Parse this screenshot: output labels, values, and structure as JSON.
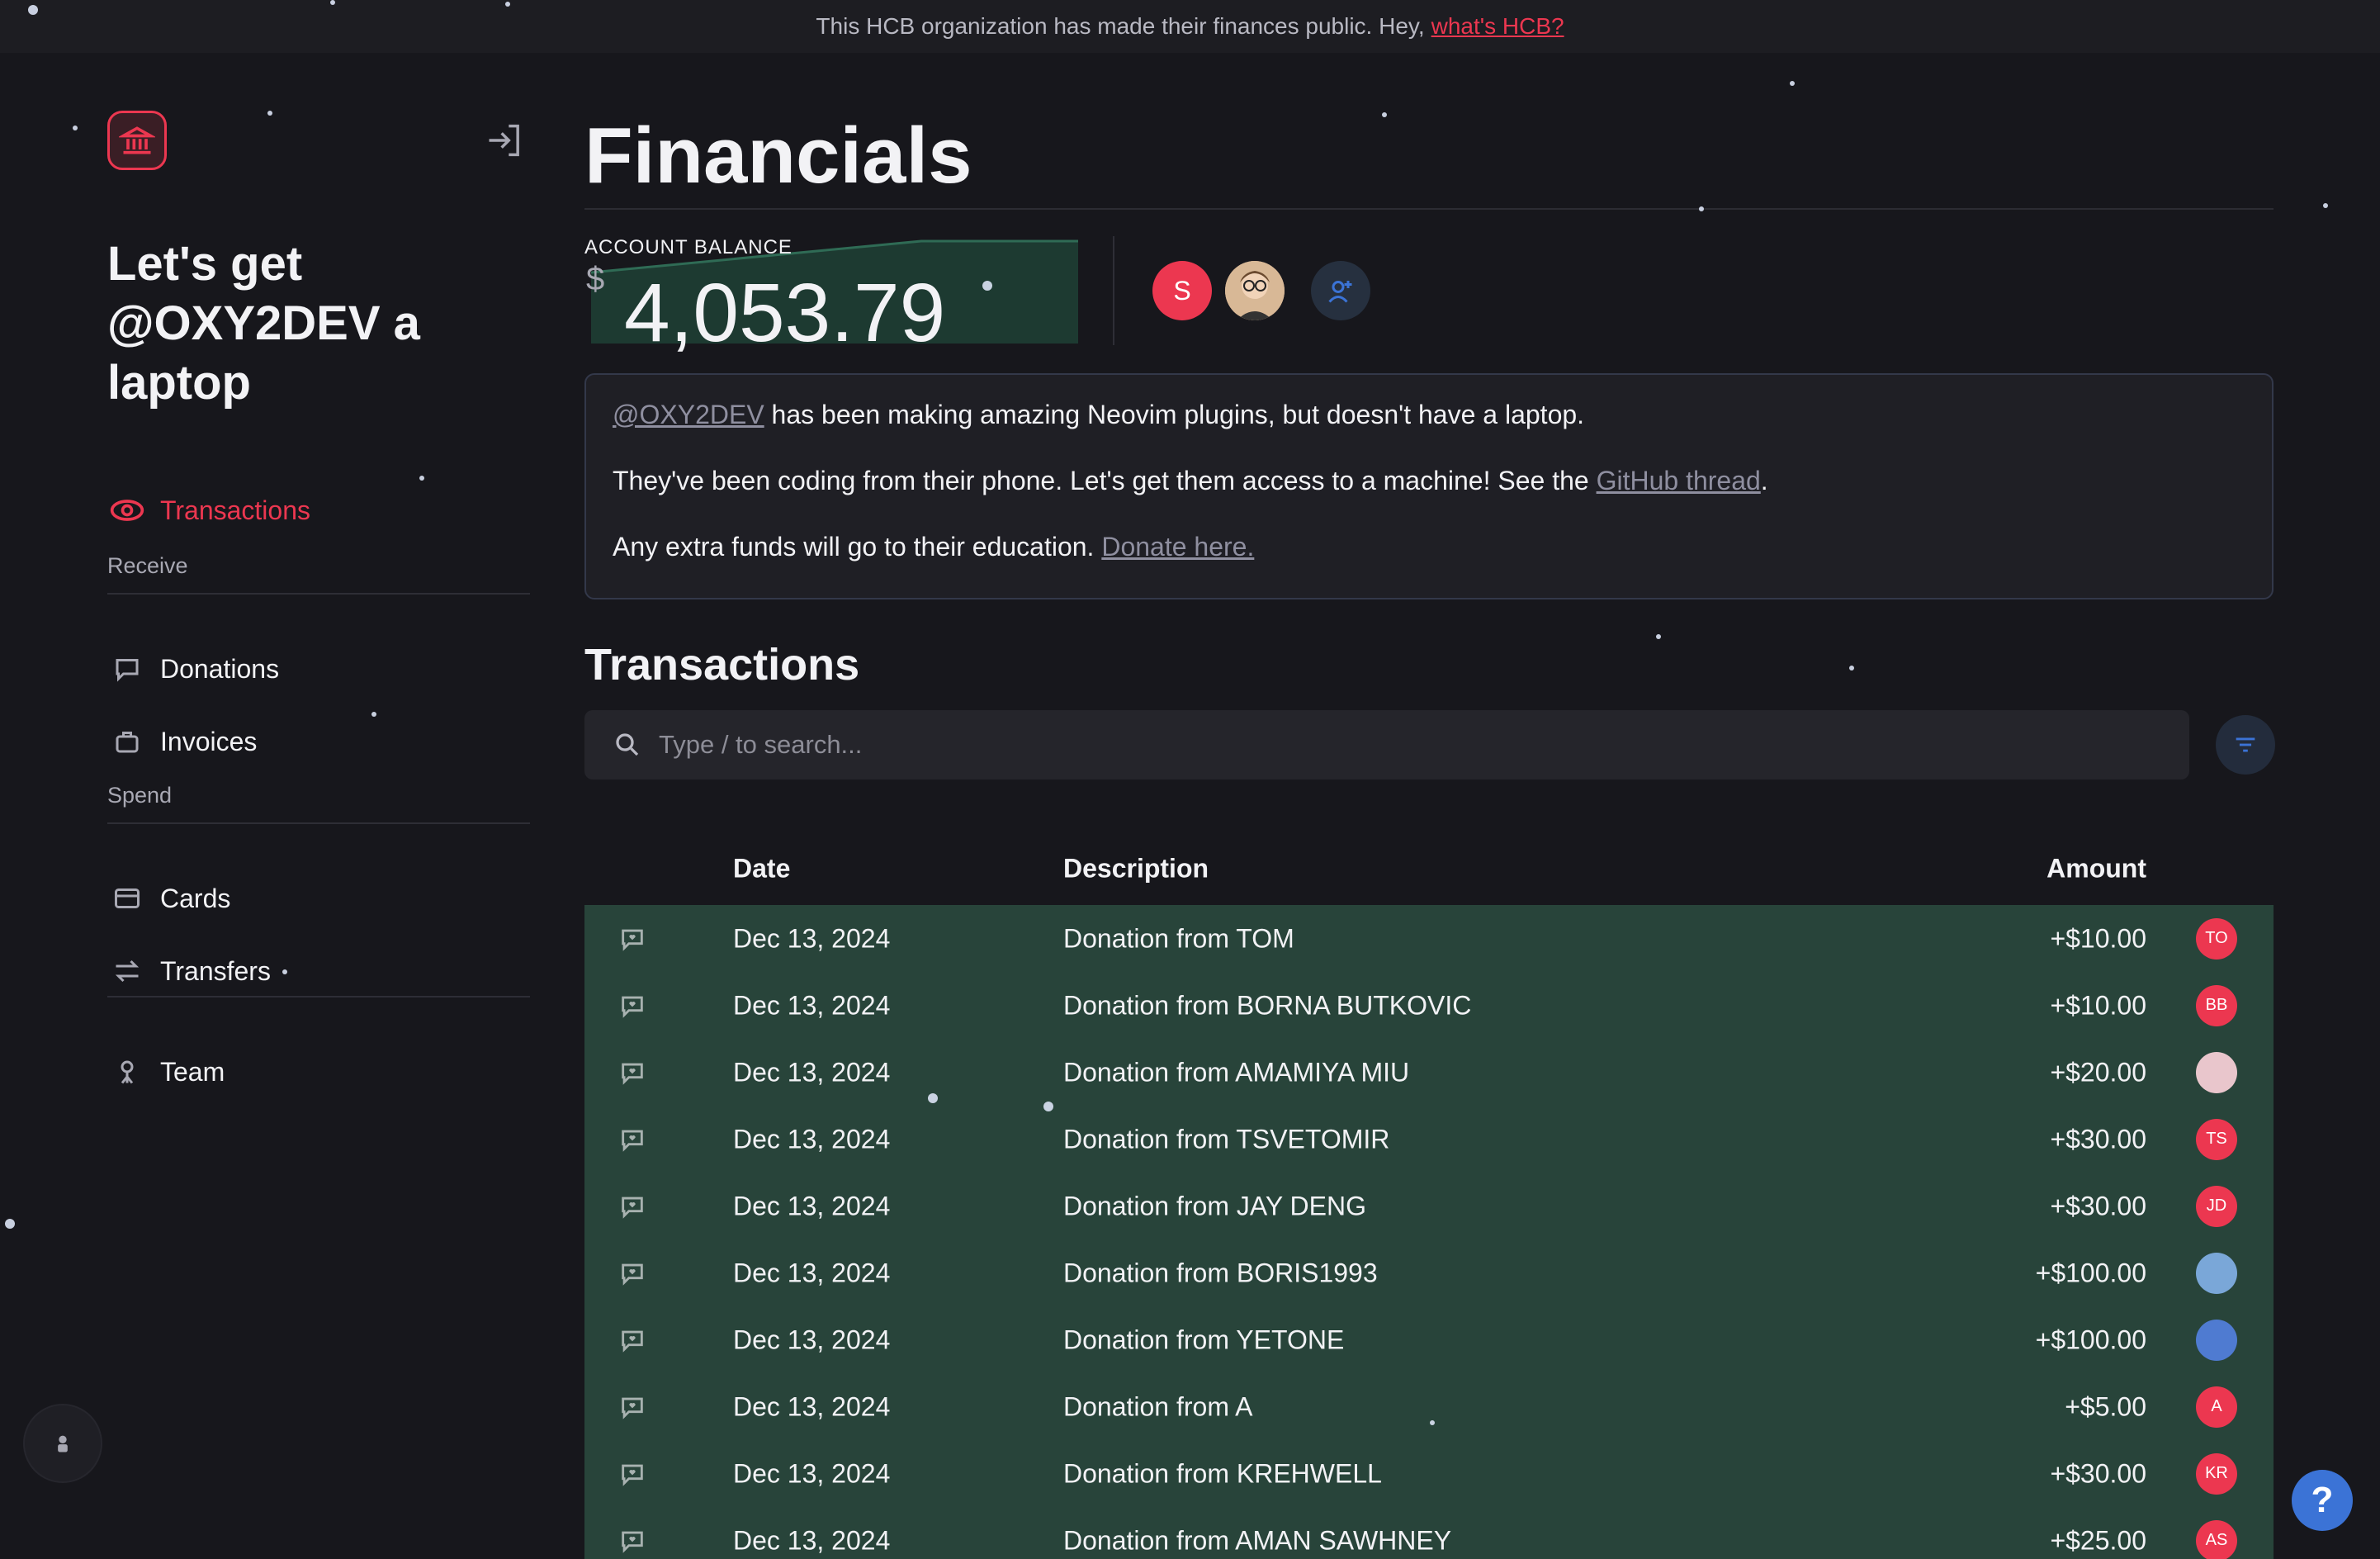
{
  "banner": {
    "text": "This HCB organization has made their finances public. Hey,",
    "link": "what's HCB?"
  },
  "sidebar": {
    "org_name": "Let's get @OXY2DEV a laptop",
    "nav": {
      "transactions": "Transactions",
      "receive_section": "Receive",
      "donations": "Donations",
      "invoices": "Invoices",
      "spend_section": "Spend",
      "cards": "Cards",
      "transfers": "Transfers",
      "team": "Team"
    }
  },
  "main": {
    "title": "Financials",
    "balance": {
      "label": "ACCOUNT BALANCE",
      "currency": "$",
      "value": "4,053.79"
    },
    "team_avatars": [
      {
        "initials": "S",
        "color": "#ec3750"
      }
    ],
    "description": {
      "line1_handle": "@OXY2DEV",
      "line1_text": " has been making amazing Neovim plugins, but doesn't have a laptop.",
      "line2_text": "They've been coding from their phone. Let's get them access to a machine! See the ",
      "line2_link": "GitHub thread",
      "line2_end": ".",
      "line3_text": "Any extra funds will go to their education. ",
      "line3_link": "Donate here."
    },
    "transactions_title": "Transactions",
    "search": {
      "placeholder": "Type / to search..."
    },
    "table": {
      "headers": {
        "date": "Date",
        "description": "Description",
        "amount": "Amount"
      },
      "rows": [
        {
          "date": "Dec 13, 2024",
          "description": "Donation from TOM",
          "amount": "+$10.00",
          "avatar": "TO"
        },
        {
          "date": "Dec 13, 2024",
          "description": "Donation from BORNA BUTKOVIC",
          "amount": "+$10.00",
          "avatar": "BB"
        },
        {
          "date": "Dec 13, 2024",
          "description": "Donation from AMAMIYA MIU",
          "amount": "+$20.00",
          "avatar": ""
        },
        {
          "date": "Dec 13, 2024",
          "description": "Donation from TSVETOMIR",
          "amount": "+$30.00",
          "avatar": "TS"
        },
        {
          "date": "Dec 13, 2024",
          "description": "Donation from JAY DENG",
          "amount": "+$30.00",
          "avatar": "JD"
        },
        {
          "date": "Dec 13, 2024",
          "description": "Donation from BORIS1993",
          "amount": "+$100.00",
          "avatar": ""
        },
        {
          "date": "Dec 13, 2024",
          "description": "Donation from YETONE",
          "amount": "+$100.00",
          "avatar": ""
        },
        {
          "date": "Dec 13, 2024",
          "description": "Donation from A",
          "amount": "+$5.00",
          "avatar": "A"
        },
        {
          "date": "Dec 13, 2024",
          "description": "Donation from KREHWELL",
          "amount": "+$30.00",
          "avatar": "KR"
        },
        {
          "date": "Dec 13, 2024",
          "description": "Donation from AMAN SAWHNEY",
          "amount": "+$25.00",
          "avatar": "AS"
        }
      ]
    }
  },
  "help_label": "?",
  "colors": {
    "accent": "#ec3750",
    "row_bg": "#28443a",
    "bg": "#17171c"
  }
}
